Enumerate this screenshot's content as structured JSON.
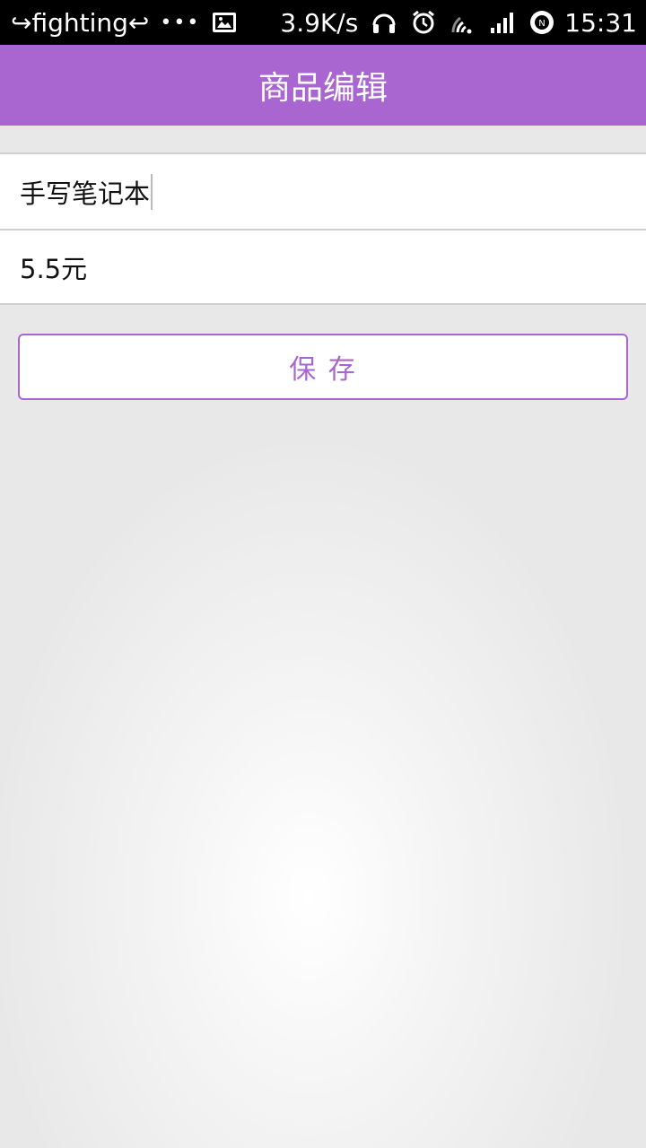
{
  "status_bar": {
    "notification": "↪fighting↩",
    "dots": "•••",
    "speed": "3.9K/s",
    "time": "15:31",
    "icons": [
      "image-icon",
      "headset-icon",
      "alarm-icon",
      "wifi-icon",
      "signal-icon",
      "nfc-icon"
    ]
  },
  "header": {
    "title": "商品编辑"
  },
  "form": {
    "name_value": "手写笔记本",
    "price_value": "5.5元"
  },
  "actions": {
    "save_label": "保 存"
  },
  "colors": {
    "accent": "#a966d0",
    "background": "#e8e8e8"
  }
}
